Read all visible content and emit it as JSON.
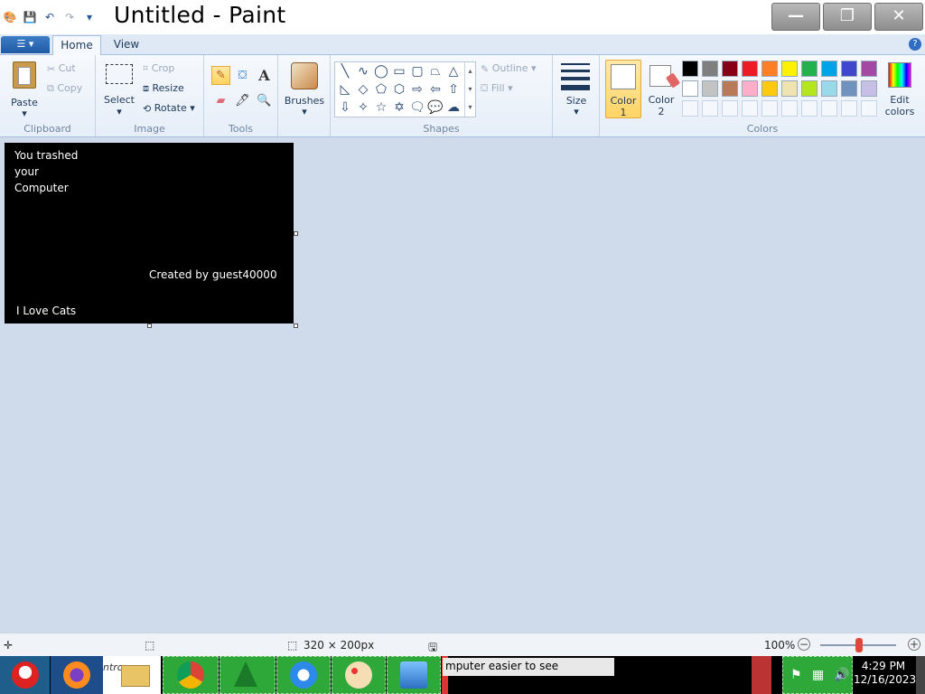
{
  "window": {
    "title": "Untitled - Paint",
    "minimize_icon": "minimize-icon",
    "restore_icon": "restore-icon",
    "close_icon": "close-icon"
  },
  "ribbon_tabs": {
    "file": "",
    "home": "Home",
    "view": "View"
  },
  "clipboard": {
    "paste": "Paste",
    "cut": "Cut",
    "copy": "Copy",
    "group": "Clipboard"
  },
  "image": {
    "select": "Select",
    "crop": "Crop",
    "resize": "Resize",
    "rotate": "Rotate",
    "group": "Image"
  },
  "tools": {
    "group": "Tools",
    "text_tool": "A"
  },
  "brushes": {
    "label": "Brushes"
  },
  "shapes": {
    "outline": "Outline",
    "fill": "Fill",
    "group": "Shapes"
  },
  "size": {
    "label": "Size"
  },
  "colors": {
    "color1_line1": "Color",
    "color1_line2": "1",
    "color2_line1": "Color",
    "color2_line2": "2",
    "edit_line1": "Edit",
    "edit_line2": "colors",
    "group": "Colors",
    "row1": [
      "#000000",
      "#7f7f7f",
      "#880015",
      "#ed1c24",
      "#ff7f27",
      "#fff200",
      "#22b14c",
      "#00a2e8",
      "#3f48cc",
      "#a349a4"
    ],
    "row2": [
      "#ffffff",
      "#c3c3c3",
      "#b97a57",
      "#ffaec9",
      "#ffc90e",
      "#efe4b0",
      "#b5e61d",
      "#99d9ea",
      "#7092be",
      "#c8bfe7"
    ]
  },
  "canvas": {
    "line1": "You trashed",
    "line2": "your",
    "line3": "Computer",
    "created_by": "Created by guest40000",
    "footer": "I Love Cats"
  },
  "statusbar": {
    "dimensions": "320 × 200px",
    "zoom": "100%"
  },
  "taskbar": {
    "partial_label": "ntro",
    "tooltip": "mputer easier to see",
    "time": "4:29 PM",
    "date": "12/16/2023"
  }
}
